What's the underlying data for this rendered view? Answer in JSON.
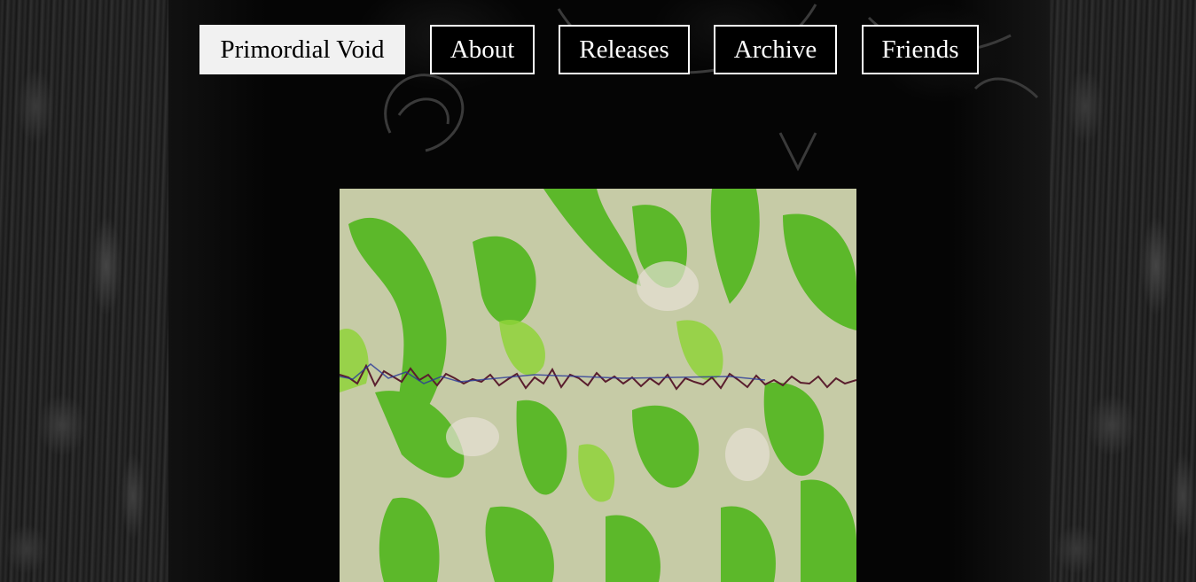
{
  "nav": {
    "items": [
      {
        "label": "Primordial Void",
        "active": true
      },
      {
        "label": "About",
        "active": false
      },
      {
        "label": "Releases",
        "active": false
      },
      {
        "label": "Archive",
        "active": false
      },
      {
        "label": "Friends",
        "active": false
      }
    ]
  },
  "colors": {
    "background": "#000000",
    "nav_border": "#ffffff",
    "nav_active_bg": "#f1f1f1",
    "video_green": "#5fbf1f",
    "video_light": "#c8cfa8"
  }
}
